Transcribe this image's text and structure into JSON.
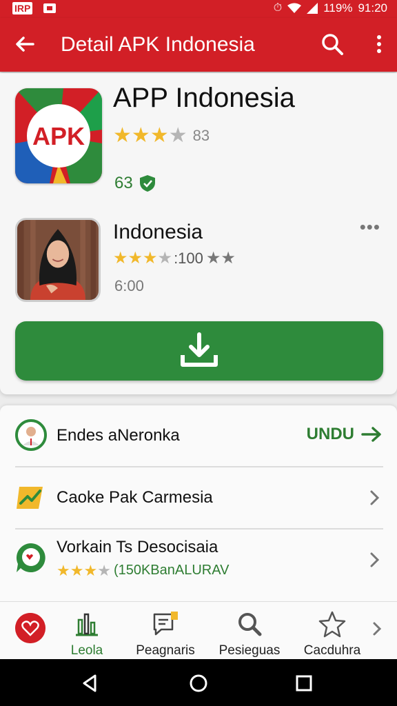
{
  "status_bar": {
    "brand": "IRP",
    "battery": "119%",
    "time": "91:20"
  },
  "app_bar": {
    "title": "Detail APK Indonesia"
  },
  "app": {
    "icon_text": "APK",
    "name": "APP Indonesia",
    "rating_stars": 3,
    "rating_count": "83",
    "score": "63"
  },
  "developer": {
    "name": "Indonesia",
    "rating_count": ":100",
    "time": "6:00"
  },
  "list": {
    "items": [
      {
        "label": "Endes aNeronka",
        "action": "UNDU"
      },
      {
        "label": "Caoke Pak Carmesia"
      },
      {
        "label": "Vorkain Ts Desocisaia",
        "sub": "(150KBanALURAV"
      }
    ]
  },
  "bottom_nav": {
    "items": [
      {
        "label": "Leola",
        "icon": "chart-icon",
        "active": true
      },
      {
        "label": "Peagnaris",
        "icon": "message-icon"
      },
      {
        "label": "Pesieguas",
        "icon": "search-icon"
      },
      {
        "label": "Cacduhra",
        "icon": "star-icon"
      }
    ]
  },
  "colors": {
    "primary": "#d21f26",
    "accent": "#2e8b3c",
    "star": "#f1b82b"
  }
}
